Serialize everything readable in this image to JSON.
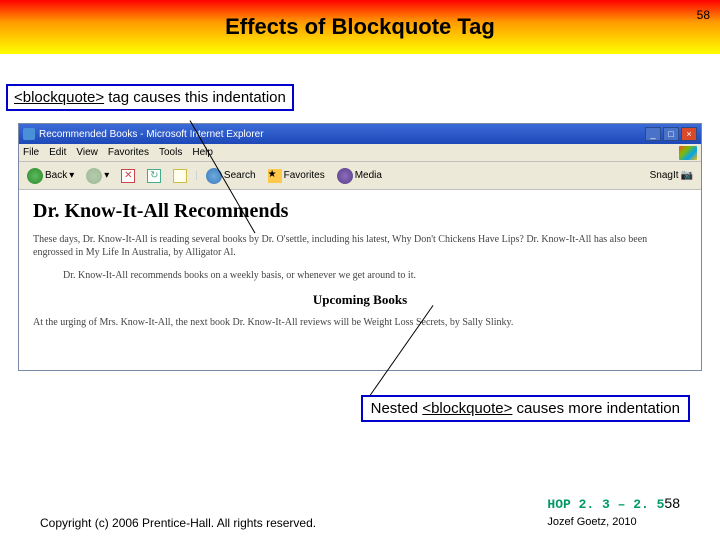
{
  "header": {
    "title": "Effects of Blockquote Tag",
    "page_num_top": "58"
  },
  "callout1": {
    "tag": "<blockquote>",
    "text": " tag causes this indentation"
  },
  "browser": {
    "window_title": "Recommended Books - Microsoft Internet Explorer",
    "menu": [
      "File",
      "Edit",
      "View",
      "Favorites",
      "Tools",
      "Help"
    ],
    "toolbar": {
      "back": "Back",
      "search": "Search",
      "favorites": "Favorites",
      "media": "Media",
      "snagit": "SnagIt"
    },
    "page": {
      "h1": "Dr. Know-It-All Recommends",
      "p1": "These days, Dr. Know-It-All is reading several books by Dr. O'settle, including his latest, Why Don't Chickens Have Lips? Dr. Know-It-All has also been engrossed in My Life In Australia, by Alligator Al.",
      "p2": "Dr. Know-It-All recommends books on a weekly basis, or whenever we get around to it.",
      "sub": "Upcoming Books",
      "p3": "At the urging of Mrs. Know-It-All, the next book Dr. Know-It-All reviews will be Weight Loss Secrets, by Sally Slinky."
    }
  },
  "callout2": {
    "text_before": "Nested ",
    "tag": "<blockquote>",
    "text_after": " causes more indentation"
  },
  "footer": {
    "copyright": "Copyright (c) 2006 Prentice-Hall. All rights reserved.",
    "hop": "HOP 2. 3 – 2. 5",
    "page": "58",
    "author": "Jozef Goetz, 2010"
  }
}
